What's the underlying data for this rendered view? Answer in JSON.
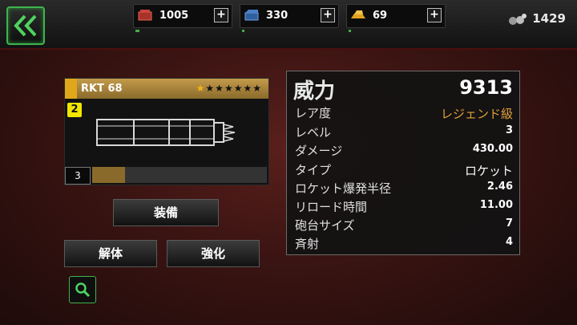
{
  "resources": [
    {
      "icon": "red-crate-icon",
      "value": "1005",
      "plus": "+"
    },
    {
      "icon": "blue-crate-icon",
      "value": "330",
      "plus": "+"
    },
    {
      "icon": "gold-bars-icon",
      "value": "69",
      "plus": "+"
    }
  ],
  "gems": {
    "icon": "gem-cluster-icon",
    "value": "1429"
  },
  "weapon": {
    "name": "RKT 68",
    "stars_filled": 1,
    "stars_total": 7,
    "slot_badge": "2",
    "xp_level": "3",
    "xp_progress": 0.19
  },
  "actions": {
    "equip": "装備",
    "dismantle": "解体",
    "upgrade": "強化"
  },
  "stats": {
    "power_label": "威力",
    "power_value": "9313",
    "rows": [
      {
        "label": "レア度",
        "value": "レジェンド級"
      },
      {
        "label": "レベル",
        "value": "3"
      },
      {
        "label": "ダメージ",
        "value": "430.00"
      },
      {
        "label": "タイプ",
        "value": "ロケット"
      },
      {
        "label": "ロケット爆発半径",
        "value": "2.46"
      },
      {
        "label": "リロード時間",
        "value": "11.00"
      },
      {
        "label": "砲台サイズ",
        "value": "7"
      },
      {
        "label": "斉射",
        "value": "4"
      }
    ]
  },
  "colors": {
    "accent_green": "#3fb34f",
    "legend_gold": "#e0a23a",
    "header_gold": "#c39b4b"
  }
}
